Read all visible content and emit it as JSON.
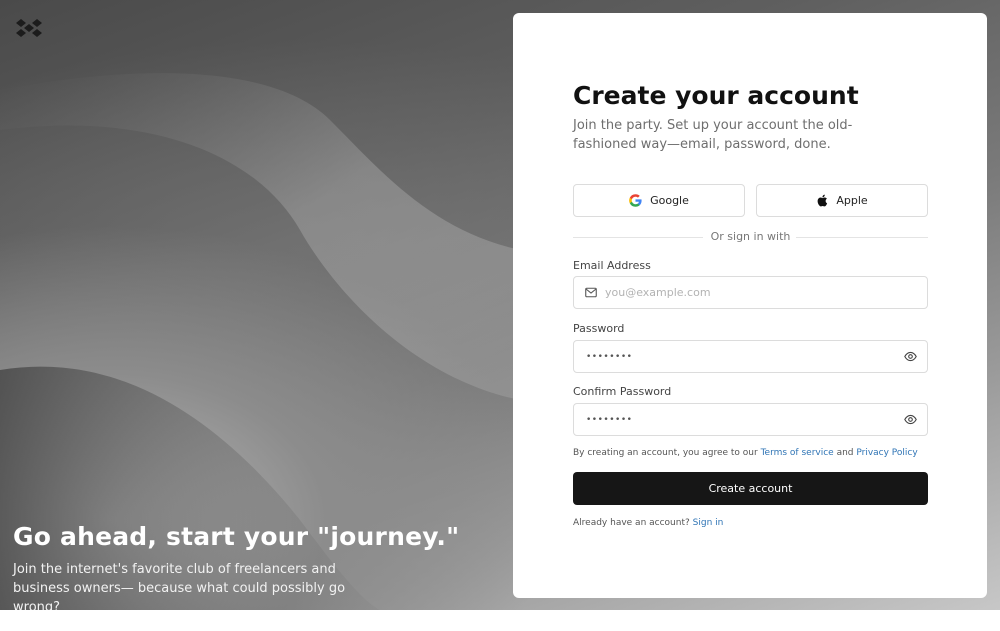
{
  "hero": {
    "title": "Go ahead, start your \"journey.\"",
    "subtitle": "Join the internet's favorite club of freelancers and business owners— because what could possibly go wrong?"
  },
  "form": {
    "title": "Create your account",
    "subtitle": "Join the party. Set up your account the old-fashioned way—email, password, done.",
    "social": {
      "google_label": "Google",
      "apple_label": "Apple"
    },
    "divider_text": "Or sign in with",
    "email": {
      "label": "Email Address",
      "placeholder": "you@example.com",
      "icon": "mail-icon"
    },
    "password": {
      "label": "Password",
      "placeholder": "••••••••",
      "icon": "eye-icon"
    },
    "confirm_password": {
      "label": "Confirm Password",
      "placeholder": "••••••••",
      "icon": "eye-icon"
    },
    "terms": {
      "prefix": "By creating an account, you agree to our ",
      "terms_link": "Terms of service",
      "middle": " and ",
      "privacy_link": "Privacy Policy"
    },
    "submit_label": "Create account",
    "signin": {
      "prefix": "Already have an account? ",
      "link": "Sign in"
    }
  },
  "colors": {
    "primary_button": "#161616",
    "link": "#2f74b5",
    "border": "#dcdcdc"
  }
}
